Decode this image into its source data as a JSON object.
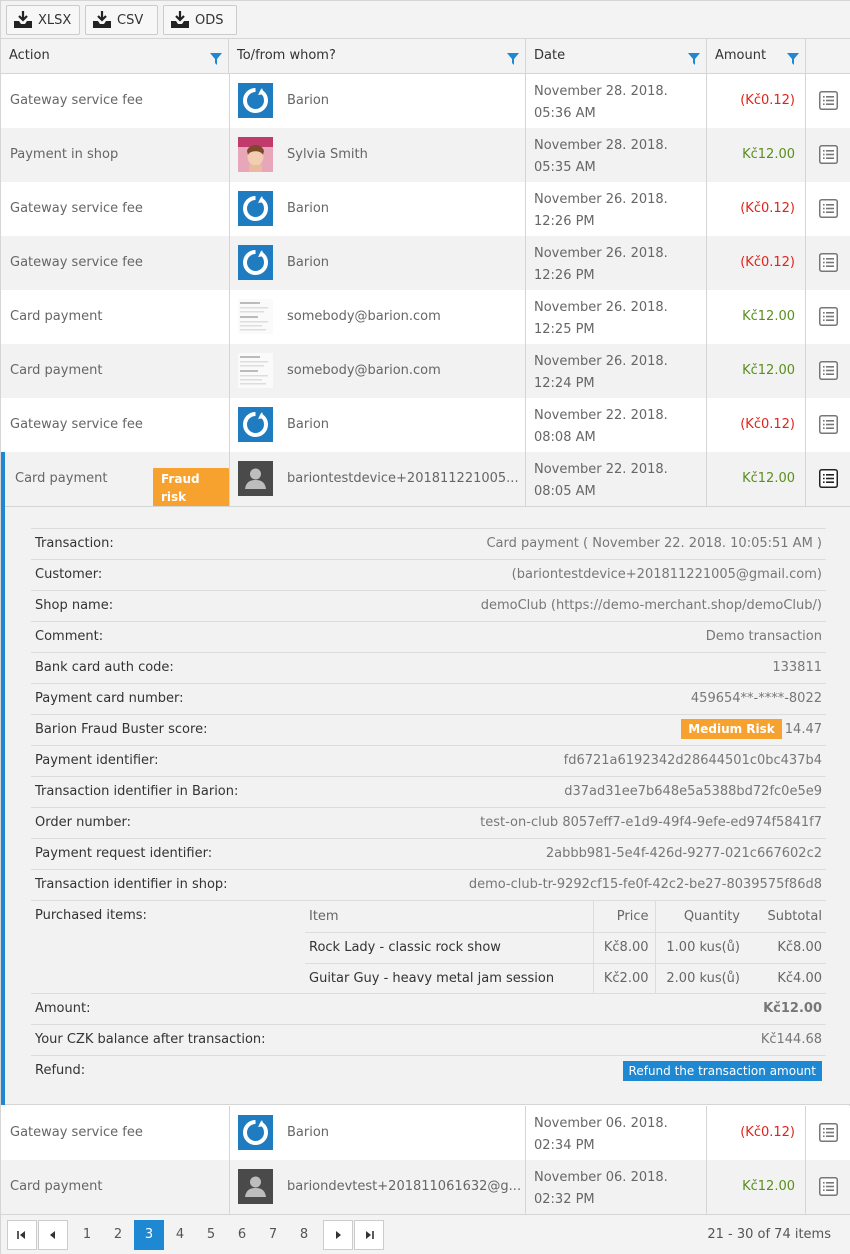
{
  "toolbar": {
    "buttons": [
      {
        "label": "XLSX",
        "icon": "download-icon"
      },
      {
        "label": "CSV",
        "icon": "download-icon"
      },
      {
        "label": "ODS",
        "icon": "download-icon"
      }
    ]
  },
  "columns": {
    "action": "Action",
    "who": "To/from whom?",
    "date": "Date",
    "amount": "Amount"
  },
  "rows": [
    {
      "action": "Gateway service fee",
      "who": "Barion",
      "date": "November 28. 2018. 05:36 AM",
      "amount": "(Kč0.12)",
      "avatar": "barion-logo"
    },
    {
      "action": "Payment in shop",
      "who": "Sylvia Smith",
      "date": "November 28. 2018. 05:35 AM",
      "amount": "Kč12.00",
      "avatar": "photo"
    },
    {
      "action": "Gateway service fee",
      "who": "Barion",
      "date": "November 26. 2018. 12:26 PM",
      "amount": "(Kč0.12)",
      "avatar": "barion-logo"
    },
    {
      "action": "Gateway service fee",
      "who": "Barion",
      "date": "November 26. 2018. 12:26 PM",
      "amount": "(Kč0.12)",
      "avatar": "barion-logo"
    },
    {
      "action": "Card payment",
      "who": "somebody@barion.com",
      "date": "November 26. 2018. 12:25 PM",
      "amount": "Kč12.00",
      "avatar": "document-thumbnail"
    },
    {
      "action": "Card payment",
      "who": "somebody@barion.com",
      "date": "November 26. 2018. 12:24 PM",
      "amount": "Kč12.00",
      "avatar": "document-thumbnail"
    },
    {
      "action": "Gateway service fee",
      "who": "Barion",
      "date": "November 22. 2018. 08:08 AM",
      "amount": "(Kč0.12)",
      "avatar": "barion-logo"
    },
    {
      "action": "Card payment",
      "badge": "Fraud risk",
      "who": "bariontestdevice+201811221005...",
      "date": "November 22. 2018. 08:05 AM",
      "amount": "Kč12.00",
      "avatar": "user-silhouette"
    },
    {
      "action": "Gateway service fee",
      "who": "Barion",
      "date": "November 06. 2018. 02:34 PM",
      "amount": "(Kč0.12)",
      "avatar": "barion-logo"
    },
    {
      "action": "Card payment",
      "who": "bariondevtest+201811061632@g...",
      "date": "November 06. 2018. 02:32 PM",
      "amount": "Kč12.00",
      "avatar": "user-silhouette"
    }
  ],
  "details": {
    "fields": [
      {
        "label": "Transaction:",
        "value": "Card payment ( November 22. 2018. 10:05:51 AM )"
      },
      {
        "label": "Customer:",
        "value": "(bariontestdevice+201811221005@gmail.com)"
      },
      {
        "label": "Shop name:",
        "value": "demoClub (https://demo-merchant.shop/demoClub/)"
      },
      {
        "label": "Comment:",
        "value": "Demo transaction"
      },
      {
        "label": "Bank card auth code:",
        "value": "133811"
      },
      {
        "label": "Payment card number:",
        "value": "459654**-****-8022"
      },
      {
        "label": "Barion Fraud Buster score:",
        "value": "14.47",
        "badge": "Medium Risk"
      },
      {
        "label": "Payment identifier:",
        "value": "fd6721a6192342d28644501c0bc437b4"
      },
      {
        "label": "Transaction identifier in Barion:",
        "value": "d37ad31ee7b648e5a5388bd72fc0e5e9"
      },
      {
        "label": "Order number:",
        "value": "test-on-club 8057eff7-e1d9-49f4-9efe-ed974f5841f7"
      },
      {
        "label": "Payment request identifier:",
        "value": "2abbb981-5e4f-426d-9277-021c667602c2"
      },
      {
        "label": "Transaction identifier in shop:",
        "value": "demo-club-tr-9292cf15-fe0f-42c2-be27-8039575f86d8"
      }
    ],
    "purchased_label": "Purchased items:",
    "items_header": {
      "item": "Item",
      "price": "Price",
      "qty": "Quantity",
      "subtotal": "Subtotal"
    },
    "items": [
      {
        "item": "Rock Lady - classic rock show",
        "price": "Kč8.00",
        "qty": "1.00 kus(ů)",
        "subtotal": "Kč8.00"
      },
      {
        "item": "Guitar Guy - heavy metal jam session",
        "price": "Kč2.00",
        "qty": "2.00 kus(ů)",
        "subtotal": "Kč4.00"
      }
    ],
    "amount_label": "Amount:",
    "amount_value": "Kč12.00",
    "balance_label": "Your CZK balance after transaction:",
    "balance_value": "Kč144.68",
    "refund_label": "Refund:",
    "refund_button": "Refund the transaction amount"
  },
  "pager": {
    "pages": [
      "1",
      "2",
      "3",
      "4",
      "5",
      "6",
      "7",
      "8"
    ],
    "current": "3",
    "info": "21 - 30 of 74 items"
  },
  "colors": {
    "accent": "#1e88d3",
    "negative": "#e2231a",
    "positive": "#5a8f1c",
    "warning": "#f7a12f"
  }
}
